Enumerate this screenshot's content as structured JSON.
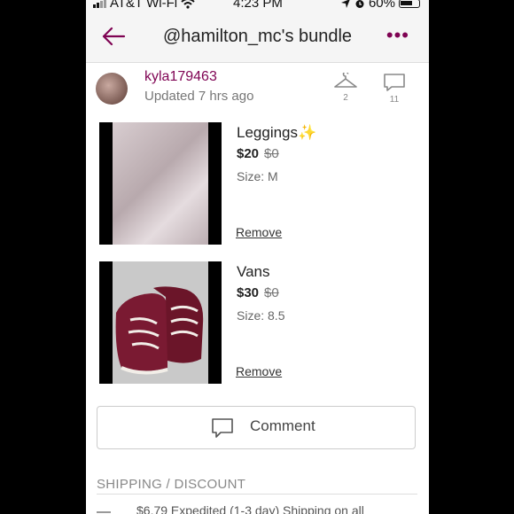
{
  "status_bar": {
    "carrier": "AT&T Wi-Fi",
    "time": "4:23 PM",
    "battery": "60%"
  },
  "header": {
    "title": "@hamilton_mc's bundle"
  },
  "seller": {
    "username": "kyla179463",
    "updated": "Updated 7 hrs ago"
  },
  "stats": {
    "likes": "2",
    "comments": "11"
  },
  "items": [
    {
      "name": "Leggings✨",
      "price": "$20",
      "original_price": "$0",
      "size": "Size: M",
      "remove_label": "Remove"
    },
    {
      "name": "Vans",
      "price": "$30",
      "original_price": "$0",
      "size": "Size: 8.5",
      "remove_label": "Remove"
    }
  ],
  "comment_button": {
    "label": "Comment"
  },
  "shipping": {
    "title": "SHIPPING / DISCOUNT",
    "text": "$6.79 Expedited (1-3 day) Shipping on all"
  },
  "colors": {
    "accent": "#7f0353"
  }
}
